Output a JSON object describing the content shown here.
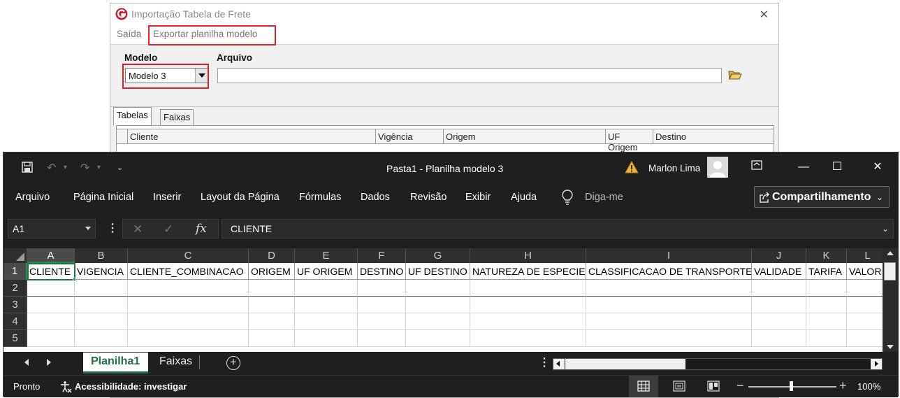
{
  "import_window": {
    "title": "Importação Tabela de Frete",
    "menu": {
      "saida": "Saída",
      "exportar": "Exportar planilha modelo"
    },
    "modelo_label": "Modelo",
    "modelo_value": "Modelo 3",
    "arquivo_label": "Arquivo",
    "arquivo_value": "",
    "tabs": [
      "Tabelas",
      "Faixas"
    ],
    "grid_columns": [
      "Cliente",
      "Vigência",
      "Origem",
      "UF Origem",
      "Destino"
    ],
    "highlight_color": "#e0212a"
  },
  "excel": {
    "title": "Pasta1  -  Planilha modelo 3",
    "user": "Marlon Lima",
    "ribbon": [
      "Arquivo",
      "Página Inicial",
      "Inserir",
      "Layout da Página",
      "Fórmulas",
      "Dados",
      "Revisão",
      "Exibir",
      "Ajuda"
    ],
    "tell_me": "Diga-me",
    "share_label": "Compartilhamento",
    "name_box": "A1",
    "formula": "CLIENTE",
    "columns": [
      "A",
      "B",
      "C",
      "D",
      "E",
      "F",
      "G",
      "H",
      "I",
      "J",
      "K",
      "L"
    ],
    "rows": [
      "1",
      "2",
      "3",
      "4",
      "5"
    ],
    "headers": [
      "CLIENTE",
      "VIGENCIA",
      "CLIENTE_COMBINACAO",
      "ORIGEM",
      "UF ORIGEM",
      "DESTINO",
      "UF DESTINO",
      "NATUREZA DE ESPECIE",
      "CLASSIFICACAO DE TRANSPORTE",
      "VALIDADE",
      "TARIFA",
      "VALOR"
    ],
    "sheets": [
      "Planilha1",
      "Faixas"
    ],
    "status": "Pronto",
    "accessibility": "Acessibilidade: investigar",
    "zoom": "100%",
    "accent_color": "#1e7145"
  }
}
